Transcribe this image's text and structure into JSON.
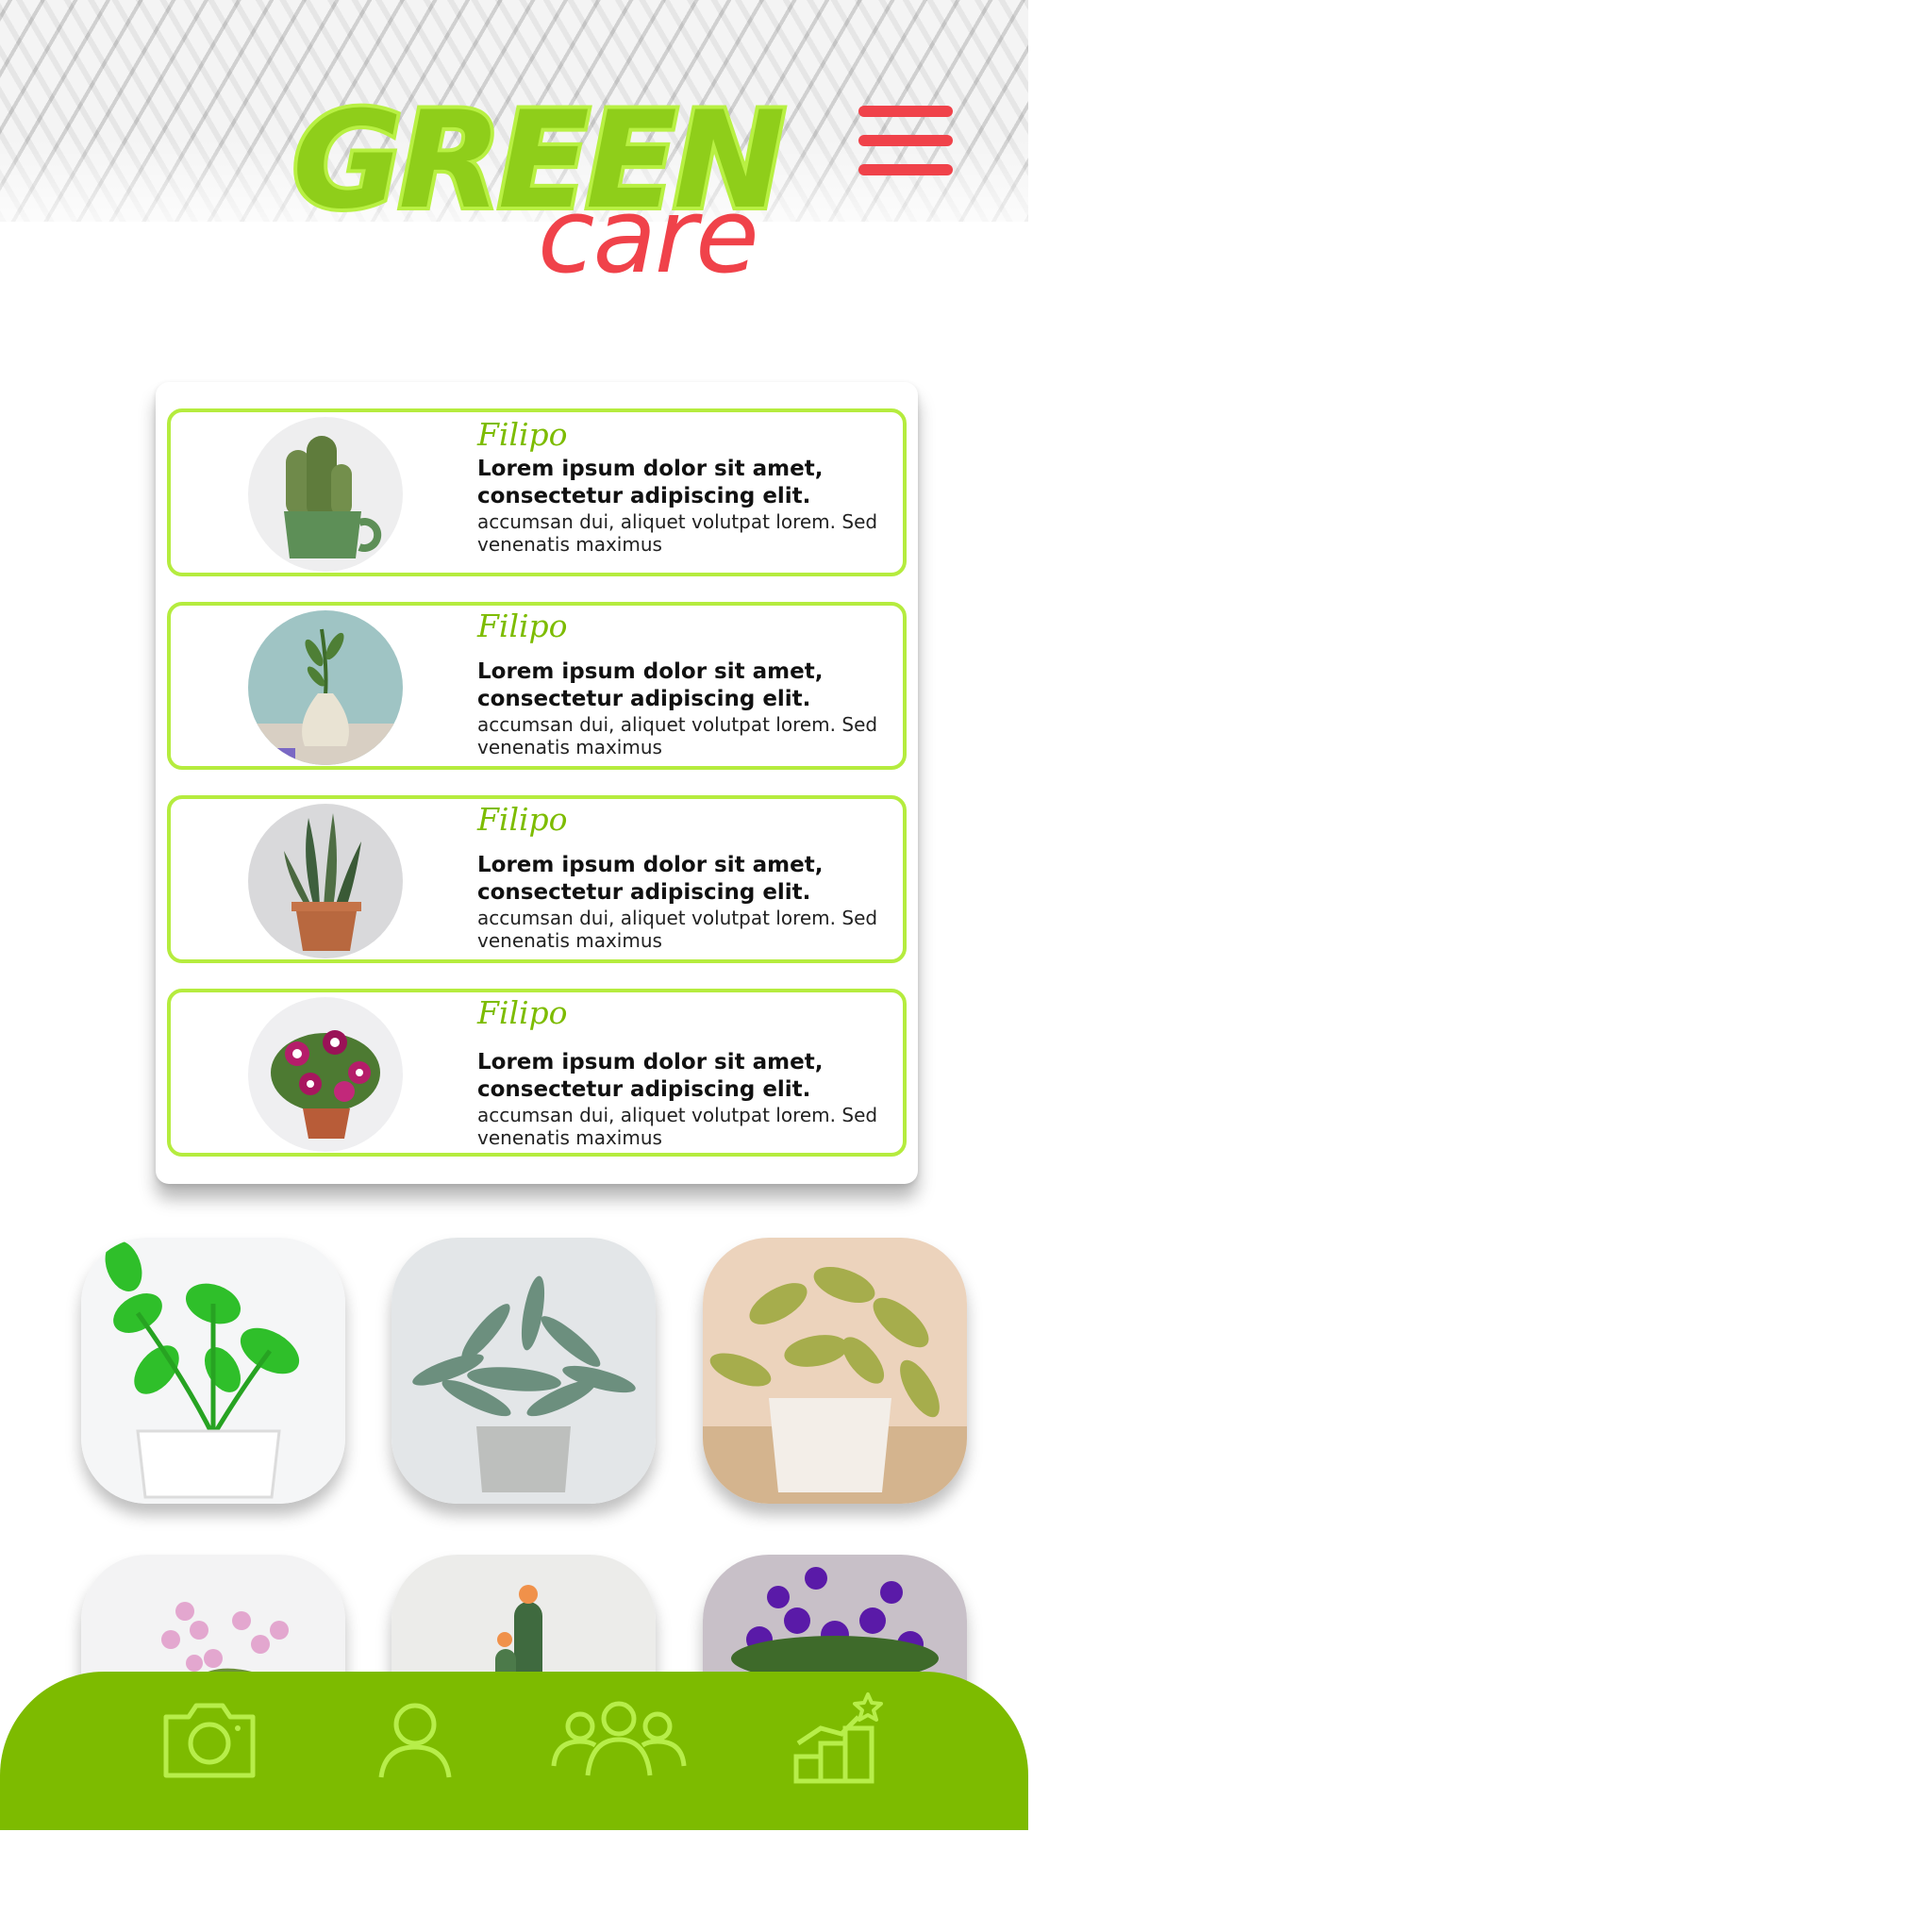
{
  "brand": {
    "word1": "GREEN",
    "word2": "care",
    "green": "#8fce1a",
    "red": "#f0424a"
  },
  "menu": {
    "icon": "hamburger-menu-icon"
  },
  "plants_list": [
    {
      "name": "Filipo",
      "lead": "Lorem ipsum dolor sit amet, consectetur adipiscing elit.",
      "body": "accumsan dui, aliquet volutpat lorem. Sed venenatis maximus",
      "image": "cactus-in-green-mug"
    },
    {
      "name": "Filipo",
      "lead": "Lorem ipsum dolor sit amet, consectetur adipiscing elit.",
      "body": "accumsan dui, aliquet volutpat lorem. Sed venenatis maximus",
      "image": "sprig-in-white-vase"
    },
    {
      "name": "Filipo",
      "lead": "Lorem ipsum dolor sit amet, consectetur adipiscing elit.",
      "body": "accumsan dui, aliquet volutpat lorem. Sed venenatis maximus",
      "image": "snake-plant-in-terracotta-pot"
    },
    {
      "name": "Filipo",
      "lead": "Lorem ipsum dolor sit amet, consectetur adipiscing elit.",
      "body": "accumsan dui, aliquet volutpat lorem. Sed venenatis maximus",
      "image": "pink-petunia-pot"
    }
  ],
  "tiles": [
    {
      "image": "green-pothos-white-planter"
    },
    {
      "image": "silver-eucalyptus-grey-pot"
    },
    {
      "image": "variegated-vine-marble-pot"
    },
    {
      "image": "pink-orchid"
    },
    {
      "image": "flowering-cactus"
    },
    {
      "image": "purple-violets"
    }
  ],
  "bottom_nav": {
    "bg": "#7dbb00",
    "icon_color": "#b7ee4a",
    "items": [
      {
        "icon": "camera-icon"
      },
      {
        "icon": "profile-icon"
      },
      {
        "icon": "community-icon"
      },
      {
        "icon": "ranking-chart-icon"
      }
    ]
  }
}
